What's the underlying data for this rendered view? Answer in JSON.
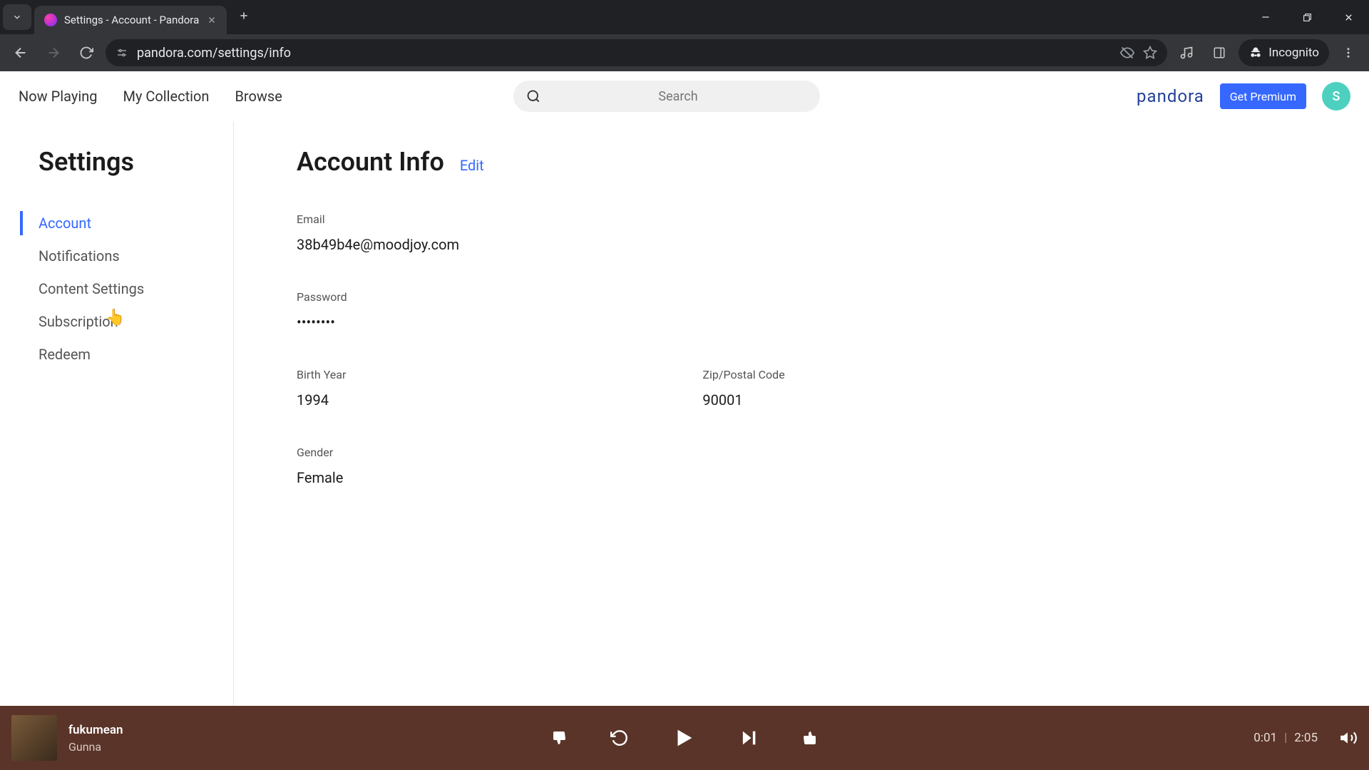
{
  "browser": {
    "tab_title": "Settings - Account - Pandora",
    "url": "pandora.com/settings/info",
    "incognito_label": "Incognito"
  },
  "nav": {
    "now_playing": "Now Playing",
    "my_collection": "My Collection",
    "browse": "Browse",
    "search_placeholder": "Search",
    "logo_text": "pandora",
    "premium_button": "Get Premium",
    "avatar_initial": "S"
  },
  "sidebar": {
    "title": "Settings",
    "items": [
      {
        "label": "Account",
        "active": true
      },
      {
        "label": "Notifications",
        "active": false
      },
      {
        "label": "Content Settings",
        "active": false
      },
      {
        "label": "Subscription",
        "active": false
      },
      {
        "label": "Redeem",
        "active": false
      }
    ]
  },
  "main": {
    "title": "Account Info",
    "edit_label": "Edit",
    "fields": {
      "email_label": "Email",
      "email_value": "38b49b4e@moodjoy.com",
      "password_label": "Password",
      "password_value": "••••••••",
      "birthyear_label": "Birth Year",
      "birthyear_value": "1994",
      "zip_label": "Zip/Postal Code",
      "zip_value": "90001",
      "gender_label": "Gender",
      "gender_value": "Female"
    }
  },
  "player": {
    "track_title": "fukumean",
    "track_artist": "Gunna",
    "elapsed": "0:01",
    "duration": "2:05"
  }
}
